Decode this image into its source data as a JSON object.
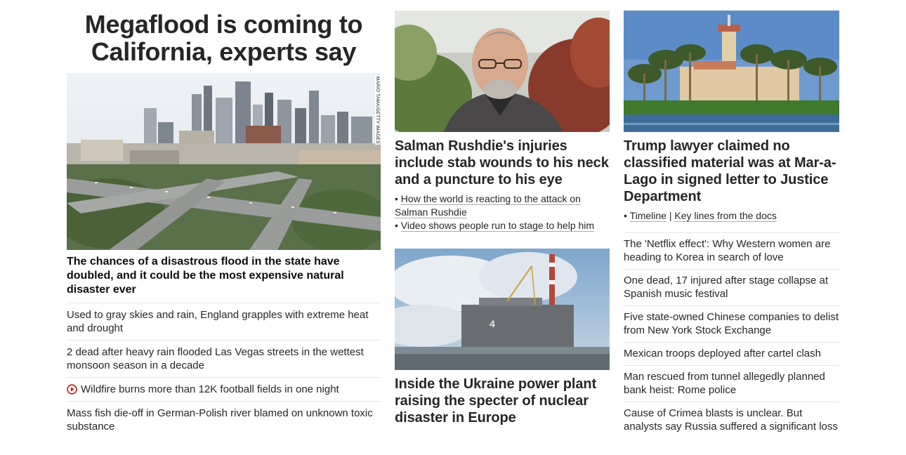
{
  "col1": {
    "headline": "Megaflood is coming to California, experts say",
    "image_credit": "MARIO TAMA/GETTY IMAGES",
    "subheadline": "The chances of a disastrous flood in the state have doubled, and it could be the most expensive natural disaster ever",
    "list": [
      "Used to gray skies and rain, England grapples with extreme heat and drought",
      "2 dead after heavy rain flooded Las Vegas streets in the wettest monsoon season in a decade",
      "Wildfire burns more than 12K football fields in one night",
      "Mass fish die-off in German-Polish river blamed on unknown toxic substance"
    ],
    "video_icon": "play-circle-icon"
  },
  "col2": {
    "card1": {
      "headline": "Salman Rushdie's injuries include stab wounds to his neck and a puncture to his eye",
      "bullet1": "How the world is reacting to the attack on Salman Rushdie",
      "bullet2": "Video shows people run to stage to help him"
    },
    "card2": {
      "headline": "Inside the Ukraine power plant raising the specter of nuclear disaster in Europe"
    }
  },
  "col3": {
    "card1": {
      "headline": "Trump lawyer claimed no classified material was at Mar-a-Lago in signed letter to Justice Department",
      "link1": "Timeline",
      "separator": "|",
      "link2": "Key lines from the docs"
    },
    "list": [
      "The 'Netflix effect': Why Western women are heading to Korea in search of love",
      "One dead, 17 injured after stage collapse at Spanish music festival",
      "Five state-owned Chinese companies to delist from New York Stock Exchange",
      "Mexican troops deployed after cartel clash",
      "Man rescued from tunnel allegedly planned bank heist: Rome police",
      "Cause of Crimea blasts is unclear. But analysts say Russia suffered a significant loss"
    ]
  },
  "colors": {
    "text": "#262626",
    "divider": "#e6e6e6",
    "play": "#cc0000"
  }
}
